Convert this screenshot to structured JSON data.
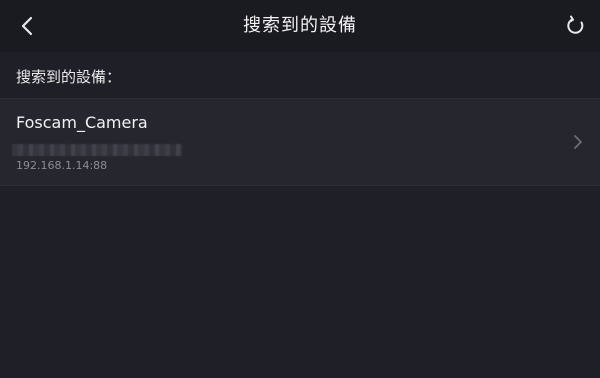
{
  "header": {
    "title": "搜索到的設備",
    "back_icon": "chevron-left-icon",
    "refresh_icon": "refresh-icon"
  },
  "section": {
    "label": "搜索到的設備："
  },
  "devices": [
    {
      "name": "Foscam_Camera",
      "ip": "192.168.1.14:88",
      "chevron_icon": "chevron-right-icon"
    }
  ],
  "colors": {
    "background": "#1f1f27",
    "topbar": "#1a1a21",
    "row": "#26262f",
    "text_primary": "#f2f2f4",
    "text_secondary": "#8d8d96"
  }
}
